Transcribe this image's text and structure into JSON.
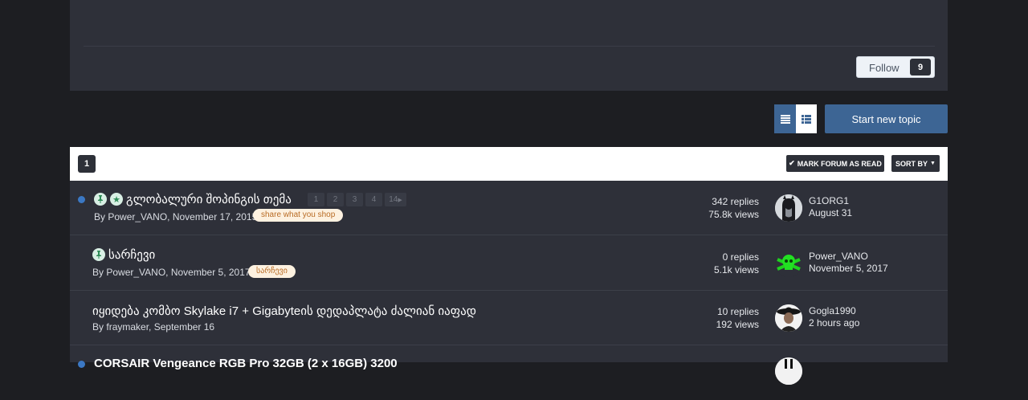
{
  "follow": {
    "label": "Follow",
    "count": "9"
  },
  "actions": {
    "start_topic": "Start new topic",
    "mark_read": "MARK FORUM AS READ",
    "sort_by": "SORT BY"
  },
  "pagination": {
    "current": "1"
  },
  "topics": [
    {
      "title": "გლობალური შოპინგის თემა",
      "pages": [
        "1",
        "2",
        "3",
        "4",
        "14"
      ],
      "author": "Power_VANO",
      "date": "November 17, 2015",
      "tag": "share what you shop",
      "replies": "342 replies",
      "views": "75.8k views",
      "last_user": "G1ORG1",
      "last_date": "August 31",
      "unread": true,
      "pinned": true,
      "featured": true
    },
    {
      "title": "სარჩევი",
      "author": "Power_VANO",
      "date": "November 5, 2017",
      "tag": "სარჩევი",
      "replies": "0 replies",
      "views": "5.1k views",
      "last_user": "Power_VANO",
      "last_date": "November 5, 2017",
      "pinned": true
    },
    {
      "title": "იყიდება კომბო Skylake i7 + Gigabyteის დედაპლატა ძალიან იაფად",
      "author": "fraymaker",
      "date": "September 16",
      "replies": "10 replies",
      "views": "192 views",
      "last_user": "Gogla1990",
      "last_date": "2 hours ago"
    },
    {
      "title": "CORSAIR Vengeance RGB Pro 32GB (2 x 16GB) 3200",
      "unread": true
    }
  ],
  "labels": {
    "by": "By"
  },
  "colors": {
    "accent": "#3d6594",
    "background": "#1d1e22",
    "panel": "#2e3039",
    "unread": "#3b78c4",
    "tag_bg": "#fdf1e0",
    "tag_text": "#b86b24"
  }
}
